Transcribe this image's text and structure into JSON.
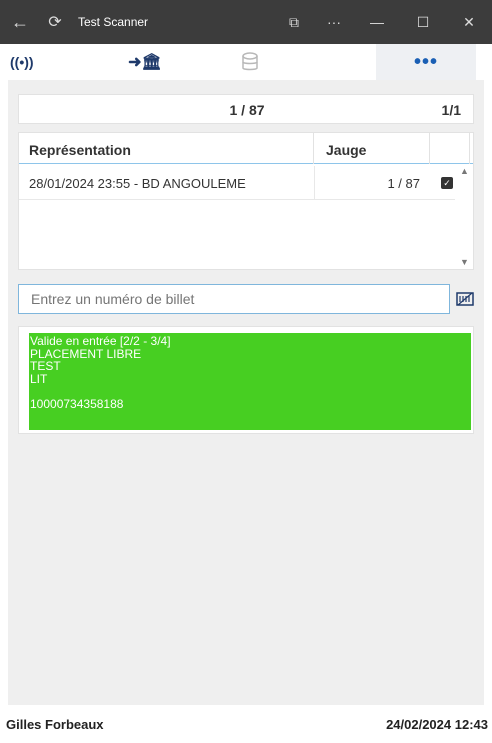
{
  "window": {
    "title": "Test Scanner",
    "back_glyph": "←",
    "app_icon_glyph": "⟳",
    "controls": {
      "cast_glyph": "⧉",
      "more_glyph": "···",
      "minimize_glyph": "—",
      "maximize_glyph": "☐",
      "close_glyph": "✕"
    }
  },
  "toolbar": {
    "signal_glyph": "((•))",
    "bank_glyph": "➜🏛",
    "db_icon": "database-icon",
    "more_glyph": "•••",
    "colors": {
      "icon": "#1f3a6b",
      "more": "#1a5fb4",
      "more_bg": "#eef0f3"
    }
  },
  "counter": {
    "center": "1 / 87",
    "right": "1/1"
  },
  "table": {
    "headers": [
      "Représentation",
      "Jauge",
      ""
    ],
    "rows": [
      {
        "representation": "28/01/2024 23:55 - BD ANGOULEME",
        "jauge": "1 / 87",
        "checked": true
      }
    ]
  },
  "search": {
    "placeholder": "Entrez un numéro de billet",
    "value": ""
  },
  "result": {
    "color": "#47cf22",
    "lines": [
      "Valide en entrée [2/2 - 3/4]",
      "PLACEMENT LIBRE",
      "TEST",
      "LIT",
      "",
      "10000734358188"
    ]
  },
  "status": {
    "user": "Gilles Forbeaux",
    "datetime": "24/02/2024 12:43"
  }
}
